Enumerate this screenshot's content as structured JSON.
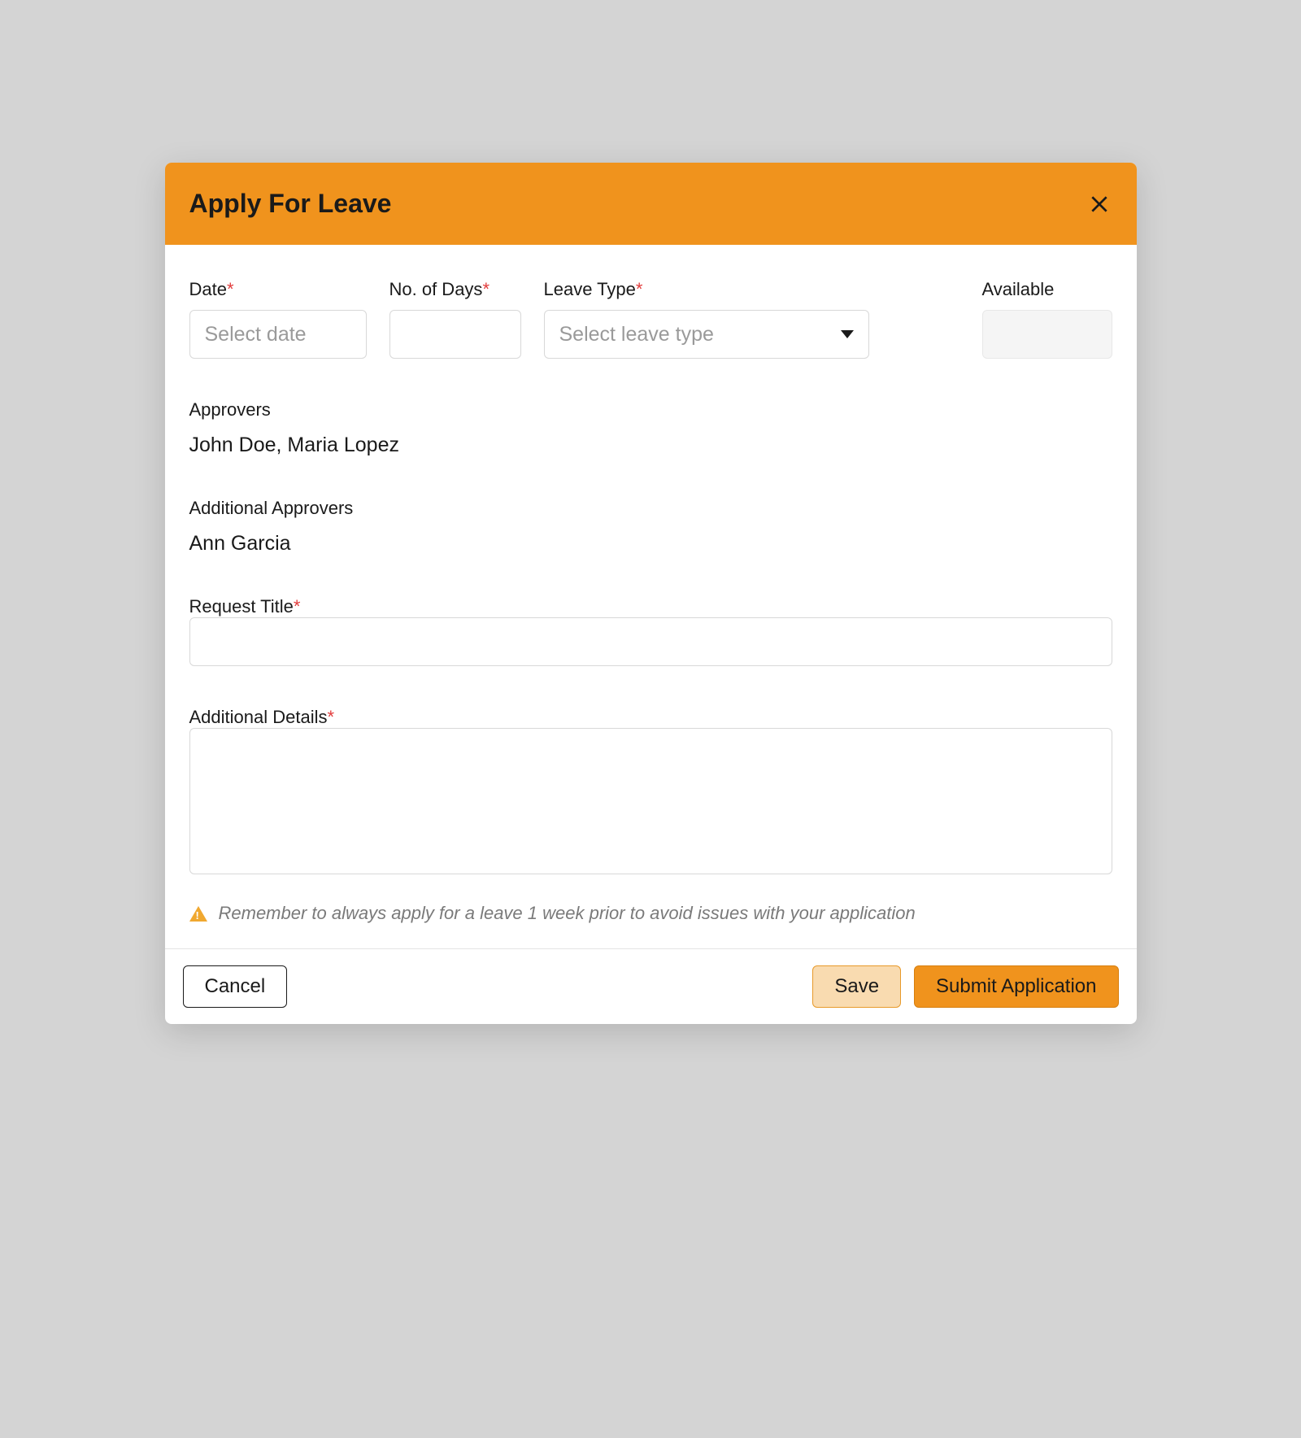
{
  "header": {
    "title": "Apply For Leave"
  },
  "form": {
    "date": {
      "label": "Date",
      "placeholder": "Select date",
      "value": ""
    },
    "days": {
      "label": "No. of Days",
      "value": ""
    },
    "leaveType": {
      "label": "Leave Type",
      "placeholder": "Select leave type",
      "value": ""
    },
    "available": {
      "label": "Available",
      "value": ""
    },
    "approvers": {
      "label": "Approvers",
      "value": "John Doe, Maria Lopez"
    },
    "additionalApprovers": {
      "label": "Additional Approvers",
      "value": "Ann Garcia"
    },
    "requestTitle": {
      "label": "Request Title",
      "value": ""
    },
    "additionalDetails": {
      "label": "Additional Details",
      "value": ""
    }
  },
  "notice": "Remember to always apply for a leave 1 week prior to avoid issues with your application",
  "footer": {
    "cancel": "Cancel",
    "save": "Save",
    "submit": "Submit Application"
  }
}
